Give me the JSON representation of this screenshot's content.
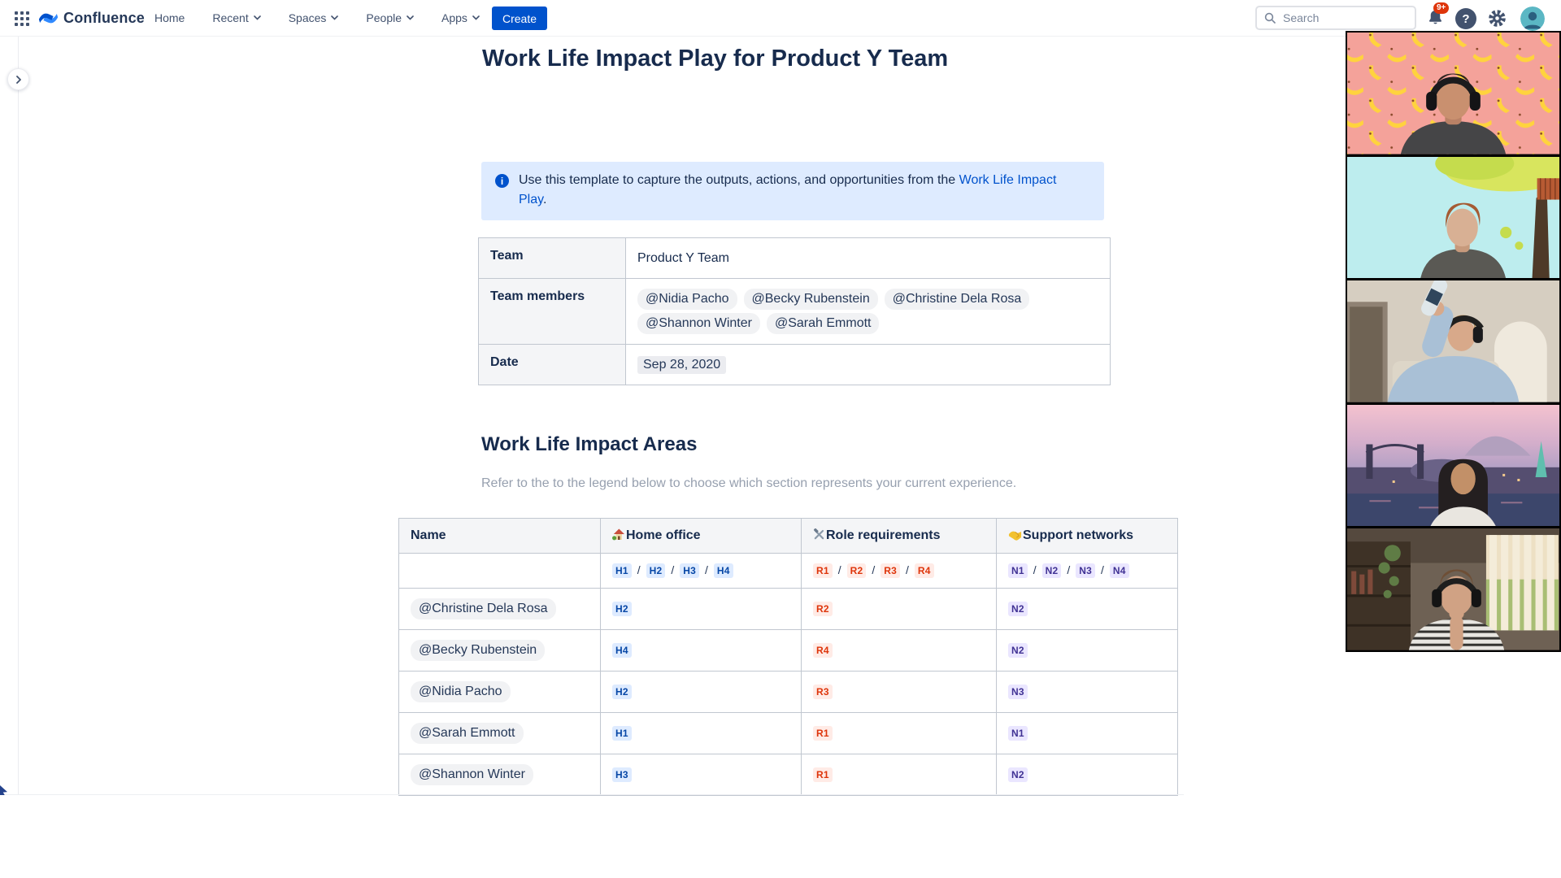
{
  "nav": {
    "brand": "Confluence",
    "items": [
      {
        "label": "Home",
        "caret": false
      },
      {
        "label": "Recent",
        "caret": true
      },
      {
        "label": "Spaces",
        "caret": true
      },
      {
        "label": "People",
        "caret": true
      },
      {
        "label": "Apps",
        "caret": true
      }
    ],
    "create_label": "Create",
    "search_placeholder": "Search",
    "notifications_badge": "9+",
    "help_glyph": "?"
  },
  "page": {
    "title": "Work Life Impact Play for Product Y Team",
    "info_panel": {
      "text_before": "Use this template to capture the outputs, actions, and opportunities from the ",
      "link_text": "Work Life Impact Play",
      "text_after": "."
    },
    "team_table": {
      "team_label": "Team",
      "team_value": "Product Y Team",
      "members_label": "Team members",
      "members": [
        "@Nidia Pacho",
        "@Becky Rubenstein",
        "@Christine Dela Rosa",
        "@Shannon Winter",
        "@Sarah Emmott"
      ],
      "date_label": "Date",
      "date_value": "Sep 28, 2020"
    },
    "section_heading": "Work Life Impact Areas",
    "section_subtitle": "Refer to the to the legend below to choose which section represents your current experience.",
    "impact_table": {
      "columns": [
        {
          "label": "Name"
        },
        {
          "label": "Home office",
          "icon": "house-icon"
        },
        {
          "label": "Role requirements",
          "icon": "tools-icon"
        },
        {
          "label": "Support networks",
          "icon": "handshake-icon"
        }
      ],
      "separator": "/",
      "legend": {
        "home": [
          "H1",
          "H2",
          "H3",
          "H4"
        ],
        "role": [
          "R1",
          "R2",
          "R3",
          "R4"
        ],
        "network": [
          "N1",
          "N2",
          "N3",
          "N4"
        ]
      },
      "rows": [
        {
          "name": "@Christine Dela Rosa",
          "home": "H2",
          "role": "R2",
          "network": "N2"
        },
        {
          "name": "@Becky Rubenstein",
          "home": "H4",
          "role": "R4",
          "network": "N2"
        },
        {
          "name": "@Nidia Pacho",
          "home": "H2",
          "role": "R3",
          "network": "N3"
        },
        {
          "name": "@Sarah Emmott",
          "home": "H1",
          "role": "R1",
          "network": "N1"
        },
        {
          "name": "@Shannon Winter",
          "home": "H3",
          "role": "R1",
          "network": "N2"
        }
      ]
    }
  },
  "video_panel": {
    "participants": [
      {
        "description": "Person wearing headphones in front of a pink banana-pattern virtual background"
      },
      {
        "description": "Person with short auburn hair in front of a cartoon treehouse virtual background"
      },
      {
        "description": "Person in a denim shirt with headphones drinking from a bottle"
      },
      {
        "description": "Person with long dark hair in front of a city skyline at dusk virtual background"
      },
      {
        "description": "Person in a striped top with headphones in a home office with window blinds"
      }
    ]
  },
  "colors": {
    "brand_blue": "#0052CC",
    "navy_text": "#172B4D",
    "nav_text": "#42526E",
    "info_bg": "#DEEBFF",
    "badge_red": "#DE350B",
    "lozenge_blue_bg": "#DEEBFF",
    "lozenge_blue_text": "#0747A6",
    "lozenge_red_bg": "#FFEBE6",
    "lozenge_red_text": "#DE350B",
    "lozenge_purple_bg": "#EAE6FF",
    "lozenge_purple_text": "#403294"
  }
}
